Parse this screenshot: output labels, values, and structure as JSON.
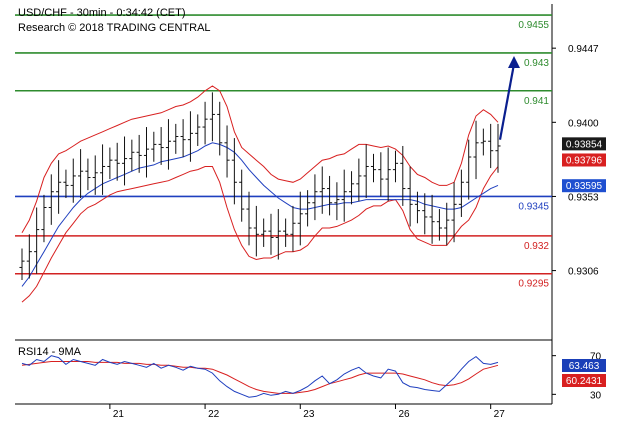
{
  "chart_data": {
    "type": "candlestick",
    "header": {
      "instrument": "USD/CHF - 30min - 0:34:42 (CET)",
      "copyright": "Research © 2018 TRADING CENTRAL"
    },
    "x_ticks": [
      "21",
      "22",
      "23",
      "26",
      "27"
    ],
    "ylim": [
      0.9262,
      0.9475
    ],
    "y_ticks": [
      "0.9447",
      "0.9400",
      "0.9353",
      "0.9306"
    ],
    "y_tick_values": [
      0.9447,
      0.94,
      0.9353,
      0.9306
    ],
    "levels": [
      {
        "label": "0.9455",
        "value": 0.9468,
        "kind": "resistance",
        "color": "#2e8b2e"
      },
      {
        "label": "0.943",
        "value": 0.9444,
        "kind": "resistance",
        "color": "#2e8b2e"
      },
      {
        "label": "0.941",
        "value": 0.942,
        "kind": "resistance",
        "color": "#2e8b2e"
      },
      {
        "label": "0.9345",
        "value": 0.9353,
        "kind": "pivot",
        "color": "#1f3fbf"
      },
      {
        "label": "0.932",
        "value": 0.9328,
        "kind": "support",
        "color": "#d22222"
      },
      {
        "label": "0.9295",
        "value": 0.9304,
        "kind": "support",
        "color": "#d22222"
      }
    ],
    "price_badges": [
      {
        "label": "0.93854",
        "value": 0.93854,
        "bg": "#1a1a1a",
        "fg": "#ffffff"
      },
      {
        "label": "0.93796",
        "value": 0.93796,
        "bg": "#d82020",
        "fg": "#ffffff"
      },
      {
        "label": "0.93595",
        "value": 0.93595,
        "bg": "#1f4fd0",
        "fg": "#ffffff"
      }
    ],
    "forecast_arrow": {
      "from_value": 0.9389,
      "to_value": 0.9442,
      "color": "#0a1f8f"
    },
    "close_series": [
      0.9312,
      0.9318,
      0.9332,
      0.9346,
      0.9356,
      0.9362,
      0.936,
      0.9366,
      0.9369,
      0.9365,
      0.9368,
      0.9372,
      0.9376,
      0.9374,
      0.9377,
      0.9381,
      0.9379,
      0.9383,
      0.9386,
      0.9384,
      0.9388,
      0.9391,
      0.9389,
      0.9393,
      0.9397,
      0.9402,
      0.9405,
      0.9387,
      0.9376,
      0.9362,
      0.9345,
      0.9333,
      0.9329,
      0.9331,
      0.9327,
      0.9331,
      0.9329,
      0.9336,
      0.9342,
      0.9349,
      0.9356,
      0.9358,
      0.9349,
      0.9351,
      0.9356,
      0.9361,
      0.9366,
      0.9372,
      0.937,
      0.9364,
      0.937,
      0.9374,
      0.9358,
      0.9348,
      0.9344,
      0.934,
      0.9337,
      0.9333,
      0.9338,
      0.9348,
      0.9362,
      0.9378,
      0.9387,
      0.9388,
      0.9382,
      0.9385
    ],
    "bollinger_upper": [
      0.933,
      0.9338,
      0.935,
      0.9365,
      0.9374,
      0.938,
      0.9382,
      0.9385,
      0.9388,
      0.939,
      0.9392,
      0.9394,
      0.9396,
      0.9398,
      0.94,
      0.9402,
      0.9403,
      0.9404,
      0.9405,
      0.9406,
      0.9408,
      0.941,
      0.9411,
      0.9413,
      0.9416,
      0.942,
      0.9423,
      0.942,
      0.941,
      0.9394,
      0.9384,
      0.938,
      0.9376,
      0.9372,
      0.9367,
      0.9364,
      0.9363,
      0.9362,
      0.9364,
      0.9368,
      0.9372,
      0.9376,
      0.9377,
      0.9379,
      0.938,
      0.9383,
      0.9386,
      0.9386,
      0.9385,
      0.9384,
      0.9385,
      0.9383,
      0.9379,
      0.9372,
      0.9367,
      0.9365,
      0.9362,
      0.936,
      0.936,
      0.9362,
      0.9374,
      0.9392,
      0.9404,
      0.9408,
      0.9405,
      0.94
    ],
    "bollinger_lower": [
      0.9286,
      0.929,
      0.9296,
      0.9305,
      0.9314,
      0.9322,
      0.933,
      0.9336,
      0.9342,
      0.9346,
      0.9348,
      0.9351,
      0.9354,
      0.9356,
      0.9357,
      0.9358,
      0.9359,
      0.936,
      0.9361,
      0.9362,
      0.9363,
      0.9365,
      0.9367,
      0.9369,
      0.937,
      0.9372,
      0.9372,
      0.9362,
      0.9346,
      0.9332,
      0.9322,
      0.9315,
      0.9313,
      0.9314,
      0.9314,
      0.9316,
      0.9318,
      0.9318,
      0.9319,
      0.9322,
      0.9328,
      0.9333,
      0.9333,
      0.9334,
      0.9336,
      0.9338,
      0.9341,
      0.9345,
      0.9347,
      0.9347,
      0.935,
      0.9351,
      0.9344,
      0.9332,
      0.9326,
      0.9324,
      0.9322,
      0.9322,
      0.9322,
      0.9328,
      0.9334,
      0.9338,
      0.9346,
      0.9358,
      0.9366,
      0.9372
    ],
    "ma_line": [
      0.9296,
      0.9302,
      0.931,
      0.9318,
      0.9326,
      0.9334,
      0.934,
      0.9346,
      0.9351,
      0.9355,
      0.9358,
      0.9361,
      0.9363,
      0.9365,
      0.9367,
      0.9369,
      0.9371,
      0.9372,
      0.9373,
      0.9375,
      0.9376,
      0.9377,
      0.9378,
      0.938,
      0.9382,
      0.9385,
      0.9387,
      0.9386,
      0.9384,
      0.9381,
      0.9376,
      0.937,
      0.9365,
      0.936,
      0.9356,
      0.9352,
      0.9349,
      0.9346,
      0.9345,
      0.9345,
      0.9346,
      0.9347,
      0.9348,
      0.9348,
      0.9349,
      0.9349,
      0.935,
      0.9351,
      0.9351,
      0.9351,
      0.9351,
      0.9351,
      0.9351,
      0.9351,
      0.935,
      0.9348,
      0.9347,
      0.9346,
      0.9345,
      0.9345,
      0.9346,
      0.9349,
      0.9352,
      0.9355,
      0.9358,
      0.936
    ],
    "rsi": {
      "title": "RSI14 - 9MA",
      "ylim": [
        20,
        80
      ],
      "y_ticks": [
        "70",
        "30"
      ],
      "y_tick_values": [
        70,
        30
      ],
      "badges": [
        {
          "label": "63.463",
          "value": 63.463,
          "bg": "#1a3fb8",
          "fg": "#ffffff"
        },
        {
          "label": "60.2431",
          "value": 60.2431,
          "bg": "#d82020",
          "fg": "#ffffff"
        }
      ],
      "rsi_series": [
        62,
        60,
        66,
        64,
        70,
        68,
        61,
        66,
        64,
        62,
        60,
        66,
        63,
        61,
        64,
        62,
        60,
        58,
        62,
        57,
        60,
        58,
        55,
        59,
        57,
        56,
        52,
        44,
        38,
        33,
        30,
        27,
        28,
        31,
        29,
        30,
        33,
        31,
        34,
        38,
        44,
        49,
        41,
        45,
        51,
        55,
        58,
        52,
        49,
        47,
        56,
        54,
        42,
        38,
        37,
        35,
        34,
        33,
        40,
        47,
        56,
        64,
        69,
        62,
        61,
        63
      ],
      "ma_series": [
        60,
        61,
        62,
        63,
        64,
        64,
        64,
        64,
        64,
        64,
        63,
        63,
        63,
        63,
        62,
        62,
        62,
        61,
        61,
        60,
        60,
        59,
        58,
        58,
        57,
        57,
        56,
        53,
        50,
        46,
        42,
        38,
        35,
        33,
        32,
        31,
        31,
        31,
        32,
        33,
        35,
        38,
        41,
        43,
        45,
        47,
        50,
        52,
        52,
        52,
        52,
        52,
        51,
        49,
        47,
        45,
        42,
        40,
        39,
        40,
        42,
        46,
        51,
        56,
        58,
        60
      ]
    }
  }
}
